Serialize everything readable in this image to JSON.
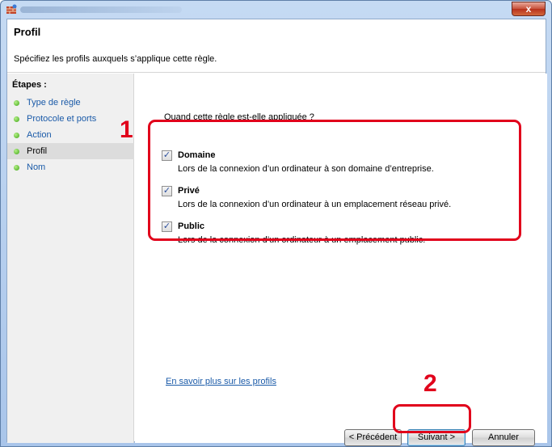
{
  "header": {
    "title": "Profil",
    "subtitle": "Spécifiez les profils auxquels s’applique cette règle."
  },
  "steps": {
    "title": "Étapes :",
    "items": [
      {
        "label": "Type de règle"
      },
      {
        "label": "Protocole et ports"
      },
      {
        "label": "Action"
      },
      {
        "label": "Profil",
        "active": true
      },
      {
        "label": "Nom"
      }
    ]
  },
  "content": {
    "question": "Quand cette règle est-elle appliquée ?",
    "options": [
      {
        "label": "Domaine",
        "checked": true,
        "description": "Lors de la connexion d’un ordinateur à son domaine d’entreprise."
      },
      {
        "label": "Privé",
        "checked": true,
        "description": "Lors de la connexion d’un ordinateur à un emplacement réseau privé."
      },
      {
        "label": "Public",
        "checked": true,
        "description": "Lors de la connexion d’un ordinateur à un emplacement public."
      }
    ],
    "learn_more": "En savoir plus sur les profils"
  },
  "buttons": {
    "prev": "< Précédent",
    "next": "Suivant >",
    "cancel": "Annuler"
  },
  "callouts": {
    "one": "1",
    "two": "2"
  },
  "window": {
    "close_glyph": "x"
  },
  "colors": {
    "callout": "#e1001b",
    "link": "#1a5aa8",
    "titlebar": "#a9c5ea"
  }
}
